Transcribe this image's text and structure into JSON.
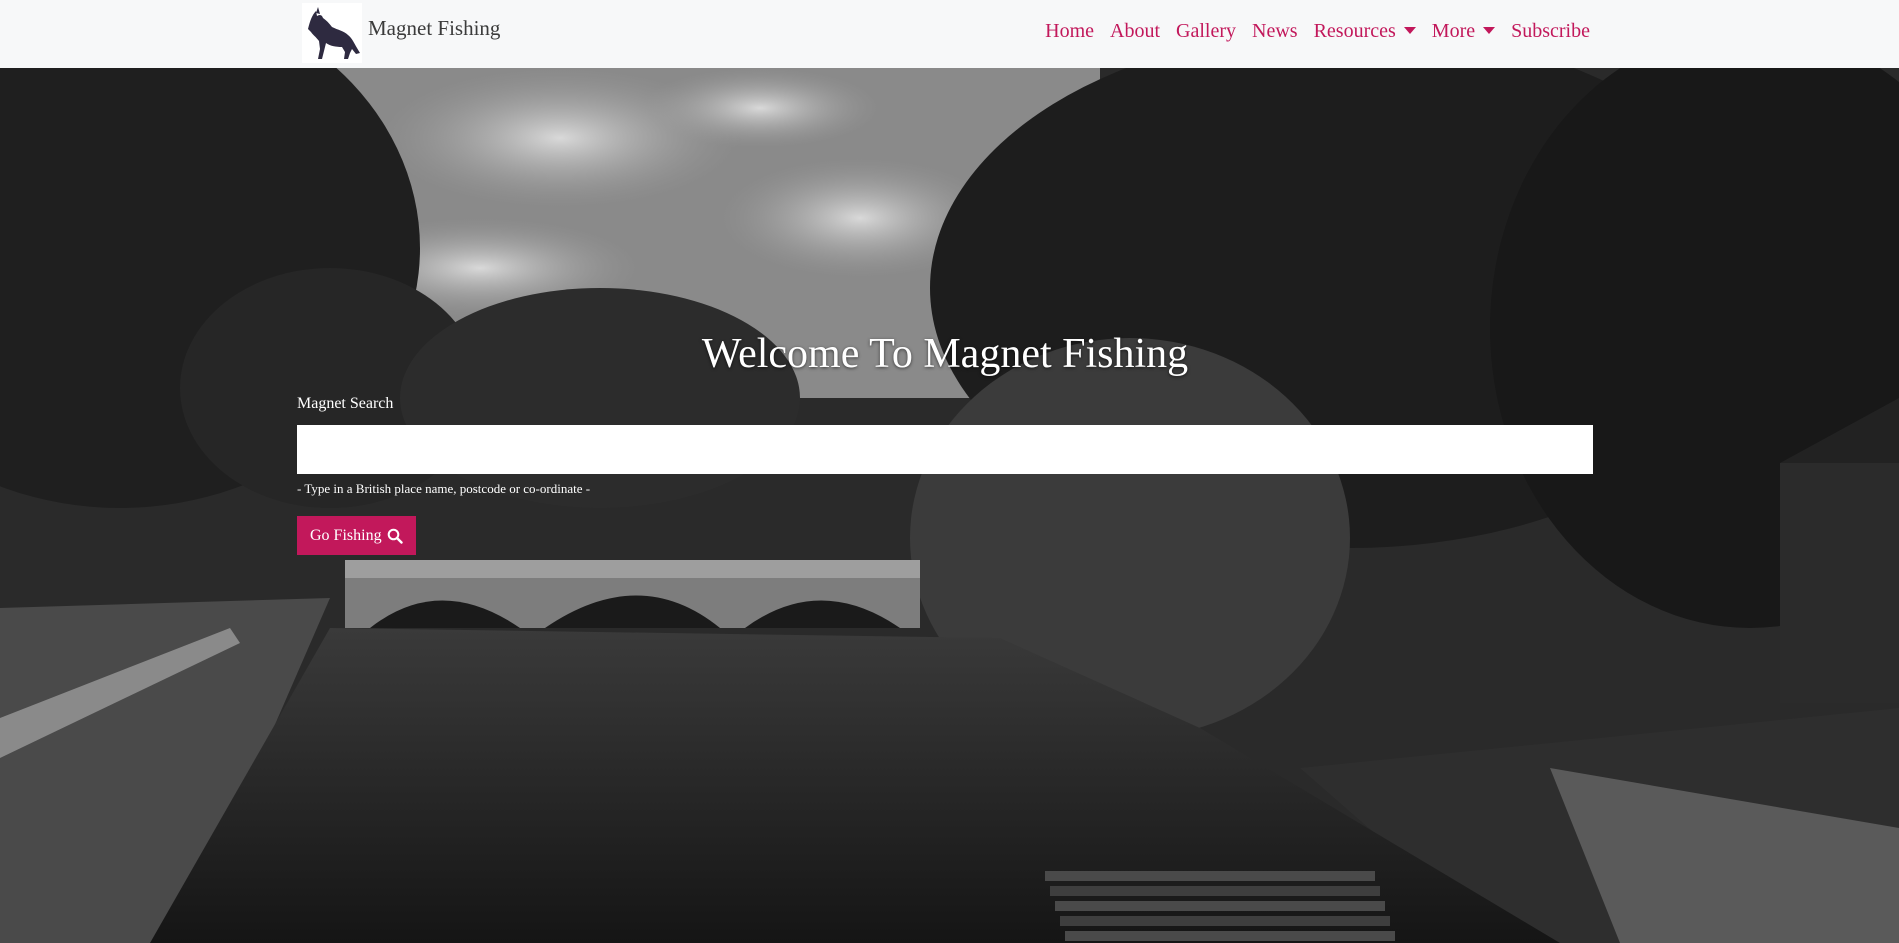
{
  "brand": {
    "name": "Magnet Fishing",
    "logo_icon": "dog-logo-icon"
  },
  "nav": {
    "items": [
      {
        "label": "Home",
        "dropdown": false
      },
      {
        "label": "About",
        "dropdown": false
      },
      {
        "label": "Gallery",
        "dropdown": false
      },
      {
        "label": "News",
        "dropdown": false
      },
      {
        "label": "Resources",
        "dropdown": true
      },
      {
        "label": "More",
        "dropdown": true
      },
      {
        "label": "Subscribe",
        "dropdown": false
      }
    ]
  },
  "hero": {
    "title": "Welcome To Magnet Fishing",
    "search_label": "Magnet Search",
    "search_value": "",
    "search_help": "- Type in a British place name, postcode or co-ordinate -",
    "button_label": "Go Fishing",
    "button_icon": "search-icon"
  },
  "colors": {
    "accent": "#c2185b",
    "navbar_bg": "#f7f8f9",
    "brand_text": "#3b3b3b"
  }
}
